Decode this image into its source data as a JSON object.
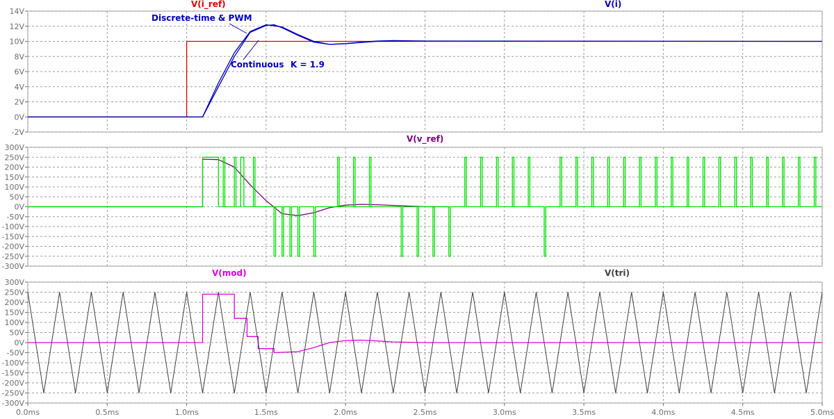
{
  "chart_data": [
    {
      "type": "line",
      "pane": "top",
      "ylim": [
        -2,
        14
      ],
      "yticks": [
        "14V",
        "12V",
        "10V",
        "8V",
        "6V",
        "4V",
        "2V",
        "0V",
        "-2V"
      ],
      "ytick_values": [
        14,
        12,
        10,
        8,
        6,
        4,
        2,
        0,
        -2
      ],
      "series": [
        {
          "name": "V(i_ref)",
          "color": "#e00000",
          "points": [
            [
              0,
              0
            ],
            [
              1.0,
              0
            ],
            [
              1.0,
              10
            ],
            [
              5.0,
              10
            ]
          ]
        },
        {
          "name": "V(i)",
          "color": "#0000c0",
          "points": [
            [
              0,
              0
            ],
            [
              1.1,
              0
            ],
            [
              1.2,
              4
            ],
            [
              1.3,
              8
            ],
            [
              1.4,
              11.2
            ],
            [
              1.5,
              12.1
            ],
            [
              1.55,
              12.2
            ],
            [
              1.6,
              11.8
            ],
            [
              1.7,
              10.8
            ],
            [
              1.8,
              9.9
            ],
            [
              1.9,
              9.6
            ],
            [
              2.0,
              9.7
            ],
            [
              2.1,
              9.9
            ],
            [
              2.2,
              10.05
            ],
            [
              2.3,
              10.1
            ],
            [
              2.5,
              10.05
            ],
            [
              5.0,
              10
            ]
          ]
        },
        {
          "name": "V(i) continuous",
          "color": "#0000c0",
          "points": [
            [
              1.1,
              0
            ],
            [
              1.2,
              4.5
            ],
            [
              1.3,
              8.5
            ],
            [
              1.4,
              11.3
            ],
            [
              1.5,
              12.2
            ],
            [
              1.6,
              11.9
            ],
            [
              1.7,
              10.9
            ],
            [
              1.8,
              10.0
            ],
            [
              1.9,
              9.6
            ],
            [
              2.0,
              9.7
            ],
            [
              2.2,
              10.0
            ],
            [
              2.5,
              10.05
            ]
          ]
        }
      ],
      "annotations": [
        "Discrete-time & PWM",
        "Continuous",
        "K = 1.9"
      ]
    },
    {
      "type": "line",
      "pane": "middle",
      "ylim": [
        -300,
        300
      ],
      "yticks": [
        "300V",
        "250V",
        "200V",
        "150V",
        "100V",
        "50V",
        "0V",
        "-50V",
        "-100V",
        "-150V",
        "-200V",
        "-250V",
        "-300V"
      ],
      "ytick_values": [
        300,
        250,
        200,
        150,
        100,
        50,
        0,
        -50,
        -100,
        -150,
        -200,
        -250,
        -300
      ],
      "series": [
        {
          "name": "V(v_ref)",
          "color": "#800080",
          "points": [
            [
              0,
              0
            ],
            [
              1.1,
              0
            ],
            [
              1.1,
              240
            ],
            [
              1.2,
              238
            ],
            [
              1.3,
              200
            ],
            [
              1.4,
              110
            ],
            [
              1.5,
              30
            ],
            [
              1.6,
              -35
            ],
            [
              1.7,
              -45
            ],
            [
              1.8,
              -30
            ],
            [
              1.9,
              -5
            ],
            [
              2.0,
              8
            ],
            [
              2.1,
              12
            ],
            [
              2.2,
              10
            ],
            [
              2.35,
              5
            ],
            [
              2.5,
              0
            ],
            [
              2.65,
              0
            ]
          ]
        },
        {
          "name": "PWM",
          "color": "#00e000",
          "pulses": [
            [
              1.1,
              1.2,
              250
            ],
            [
              1.23,
              1.24,
              250
            ],
            [
              1.3,
              1.31,
              250
            ],
            [
              1.34,
              1.36,
              250
            ],
            [
              1.42,
              1.43,
              250
            ],
            [
              1.55,
              1.56,
              -250
            ],
            [
              1.6,
              1.61,
              -250
            ],
            [
              1.65,
              1.66,
              -250
            ],
            [
              1.7,
              1.71,
              -250
            ],
            [
              1.8,
              1.81,
              -250
            ],
            [
              1.95,
              1.96,
              250
            ],
            [
              2.05,
              2.06,
              250
            ],
            [
              2.15,
              2.16,
              250
            ],
            [
              2.35,
              2.36,
              -250
            ],
            [
              2.45,
              2.46,
              -250
            ],
            [
              2.55,
              2.56,
              -250
            ],
            [
              2.65,
              2.66,
              -250
            ],
            [
              2.75,
              2.76,
              250
            ],
            [
              2.85,
              2.86,
              250
            ],
            [
              2.95,
              2.96,
              250
            ],
            [
              3.05,
              3.06,
              250
            ],
            [
              3.15,
              3.16,
              250
            ],
            [
              3.25,
              3.26,
              -250
            ],
            [
              3.35,
              3.36,
              250
            ],
            [
              3.45,
              3.46,
              250
            ],
            [
              3.55,
              3.56,
              250
            ],
            [
              3.65,
              3.66,
              250
            ],
            [
              3.75,
              3.76,
              250
            ],
            [
              3.85,
              3.86,
              250
            ],
            [
              3.95,
              3.96,
              250
            ],
            [
              4.05,
              4.06,
              250
            ],
            [
              4.15,
              4.16,
              250
            ],
            [
              4.25,
              4.26,
              250
            ],
            [
              4.35,
              4.36,
              250
            ],
            [
              4.45,
              4.46,
              250
            ],
            [
              4.55,
              4.56,
              250
            ],
            [
              4.65,
              4.66,
              250
            ],
            [
              4.75,
              4.76,
              250
            ],
            [
              4.85,
              4.86,
              250
            ],
            [
              4.95,
              4.96,
              250
            ]
          ]
        }
      ]
    },
    {
      "type": "line",
      "pane": "bottom",
      "ylim": [
        -300,
        300
      ],
      "yticks": [
        "300V",
        "250V",
        "200V",
        "150V",
        "100V",
        "50V",
        "0V",
        "-50V",
        "-100V",
        "-150V",
        "-200V",
        "-250V",
        "-300V"
      ],
      "ytick_values": [
        300,
        250,
        200,
        150,
        100,
        50,
        0,
        -50,
        -100,
        -150,
        -200,
        -250,
        -300
      ],
      "series": [
        {
          "name": "V(mod)",
          "color": "#e000e0",
          "points": [
            [
              0,
              0
            ],
            [
              1.1,
              0
            ],
            [
              1.1,
              240
            ],
            [
              1.3,
              240
            ],
            [
              1.3,
              120
            ],
            [
              1.38,
              120
            ],
            [
              1.38,
              30
            ],
            [
              1.45,
              30
            ],
            [
              1.45,
              -30
            ],
            [
              1.55,
              -30
            ],
            [
              1.55,
              -50
            ],
            [
              1.7,
              -45
            ],
            [
              1.8,
              -25
            ],
            [
              1.9,
              0
            ],
            [
              2.0,
              10
            ],
            [
              2.1,
              12
            ],
            [
              2.2,
              8
            ],
            [
              2.3,
              3
            ],
            [
              2.5,
              0
            ],
            [
              5.0,
              0
            ]
          ]
        },
        {
          "name": "V(tri)",
          "color": "#404040",
          "tri": {
            "period": 0.2,
            "amplitude": 250,
            "start": 0
          }
        }
      ]
    }
  ],
  "x_axis": {
    "xlim": [
      0,
      5
    ],
    "ticks": [
      "0.0ms",
      "0.5ms",
      "1.0ms",
      "1.5ms",
      "2.0ms",
      "2.5ms",
      "3.0ms",
      "3.5ms",
      "4.0ms",
      "4.5ms",
      "5.0ms"
    ],
    "tick_values": [
      0,
      0.5,
      1,
      1.5,
      2,
      2.5,
      3,
      3.5,
      4,
      4.5,
      5
    ]
  },
  "grid": true
}
